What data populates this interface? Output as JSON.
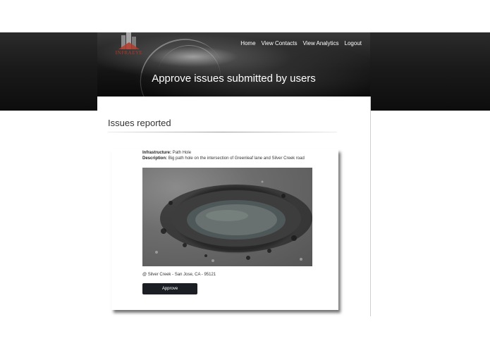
{
  "brand": {
    "logo_text": "INFRAEYE",
    "accent": "#b23a2a"
  },
  "nav": {
    "items": [
      "Home",
      "View Contacts",
      "View Analytics",
      "Logout"
    ]
  },
  "hero": {
    "title": "Approve issues submitted by users"
  },
  "main": {
    "section_title": "Issues reported"
  },
  "issue": {
    "infrastructure_label": "Infrastructure:",
    "infrastructure_value": "Path Hole",
    "description_label": "Description:",
    "description_value": "Big path hole on the intersection of Greenleaf lane and Silver Creek road",
    "location": "@ Silver Creek - San Jose, CA - 95121",
    "approve_label": "Approve",
    "photo_icon": "pothole-photo"
  }
}
